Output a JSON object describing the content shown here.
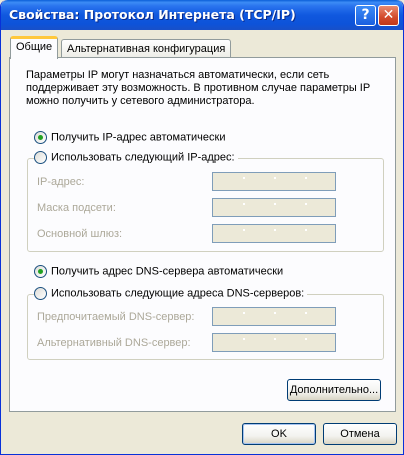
{
  "window": {
    "title": "Свойства: Протокол Интернета (TCP/IP)",
    "help_glyph": "?",
    "close_glyph": "✕"
  },
  "tabs": [
    {
      "label": "Общие",
      "active": true
    },
    {
      "label": "Альтернативная конфигурация",
      "active": false
    }
  ],
  "general": {
    "description": "Параметры IP могут назначаться автоматически, если сеть поддерживает эту возможность. В противном случае параметры IP можно получить у сетевого администратора.",
    "ip_auto": {
      "label": "Получить IP-адрес автоматически",
      "checked": true
    },
    "ip_manual": {
      "label": "Использовать следующий IP-адрес:",
      "checked": false
    },
    "ip_fields": [
      {
        "label": "IP-адрес:",
        "value": ""
      },
      {
        "label": "Маска подсети:",
        "value": ""
      },
      {
        "label": "Основной шлюз:",
        "value": ""
      }
    ],
    "dns_auto": {
      "label": "Получить адрес DNS-сервера автоматически",
      "checked": true
    },
    "dns_manual": {
      "label": "Использовать следующие адреса DNS-серверов:",
      "checked": false
    },
    "dns_fields": [
      {
        "label": "Предпочитаемый DNS-сервер:",
        "value": ""
      },
      {
        "label": "Альтернативный DNS-сервер:",
        "value": ""
      }
    ],
    "advanced_button": "Дополнительно..."
  },
  "footer": {
    "ok_button": "OK",
    "cancel_button": "Отмена"
  },
  "colors": {
    "title_bar": "#0d53d9",
    "dialog_bg": "#ece9d8",
    "radio_checked": "#21a121",
    "disabled_text": "#aca899"
  }
}
